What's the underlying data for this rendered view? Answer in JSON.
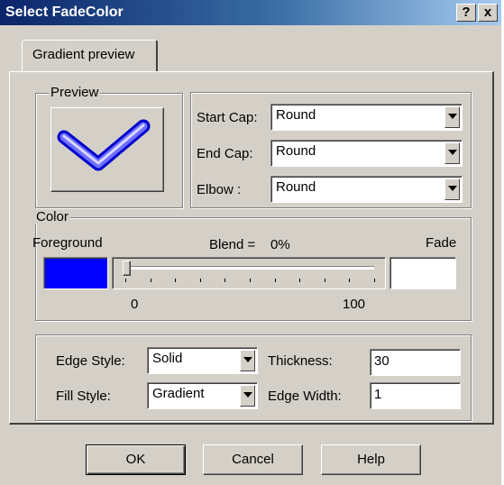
{
  "window": {
    "title": "Select FadeColor",
    "help_button": "?",
    "close_button": "x"
  },
  "tabs": [
    {
      "label": "Gradient preview"
    }
  ],
  "preview": {
    "legend": "Preview"
  },
  "caps": {
    "start_cap": {
      "label": "Start Cap:",
      "value": "Round"
    },
    "end_cap": {
      "label": "End Cap:",
      "value": "Round"
    },
    "elbow": {
      "label": "Elbow :",
      "value": "Round"
    }
  },
  "color": {
    "legend": "Color",
    "foreground_label": "Foreground",
    "blend_label": "Blend =",
    "blend_value": "0%",
    "fade_label": "Fade",
    "slider_min": "0",
    "slider_max": "100",
    "slider_value": 0,
    "foreground_color": "#0000ff",
    "fade_color": "#ffffff"
  },
  "style": {
    "edge_style": {
      "label": "Edge Style:",
      "value": "Solid"
    },
    "fill_style": {
      "label": "Fill Style:",
      "value": "Gradient"
    },
    "thickness": {
      "label": "Thickness:",
      "value": "30"
    },
    "edge_width": {
      "label": "Edge Width:",
      "value": "1"
    }
  },
  "buttons": {
    "ok": "OK",
    "cancel": "Cancel",
    "help": "Help"
  }
}
